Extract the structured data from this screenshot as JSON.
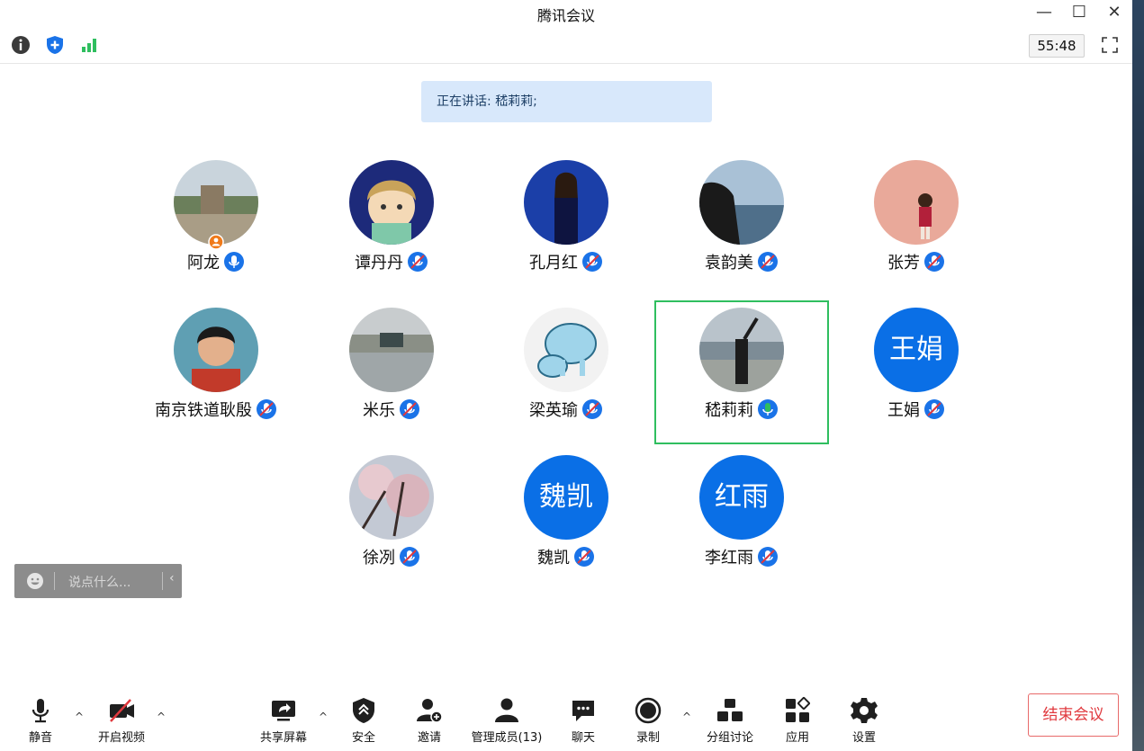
{
  "window": {
    "title": "腾讯会议"
  },
  "status": {
    "timer": "55:48"
  },
  "speaking": {
    "text": "正在讲话: 嵇莉莉;"
  },
  "participants": [
    {
      "name": "阿龙",
      "mic": "active-blue",
      "host": true
    },
    {
      "name": "谭丹丹",
      "mic": "muted"
    },
    {
      "name": "孔月红",
      "mic": "muted"
    },
    {
      "name": "袁韵美",
      "mic": "muted"
    },
    {
      "name": "张芳",
      "mic": "muted"
    },
    {
      "name": "南京铁道耿殷",
      "mic": "muted"
    },
    {
      "name": "米乐",
      "mic": "muted"
    },
    {
      "name": "梁英瑜",
      "mic": "muted"
    },
    {
      "name": "嵇莉莉",
      "mic": "speaking-green",
      "active": true
    },
    {
      "name": "王娟",
      "mic": "muted",
      "avatar_text": "王娟"
    },
    {
      "name": "徐冽",
      "mic": "muted"
    },
    {
      "name": "魏凯",
      "mic": "muted",
      "avatar_text": "魏凯"
    },
    {
      "name": "李红雨",
      "mic": "muted",
      "avatar_text": "红雨"
    }
  ],
  "chat": {
    "placeholder": "说点什么..."
  },
  "toolbar": {
    "mute": "静音",
    "video": "开启视频",
    "share": "共享屏幕",
    "security": "安全",
    "invite": "邀请",
    "members": "管理成员(13)",
    "chat": "聊天",
    "record": "录制",
    "breakout": "分组讨论",
    "apps": "应用",
    "settings": "设置",
    "end": "结束会议"
  },
  "colors": {
    "accent": "#0a6fe6",
    "speaking": "#2fbe5f",
    "danger": "#e0393e"
  }
}
